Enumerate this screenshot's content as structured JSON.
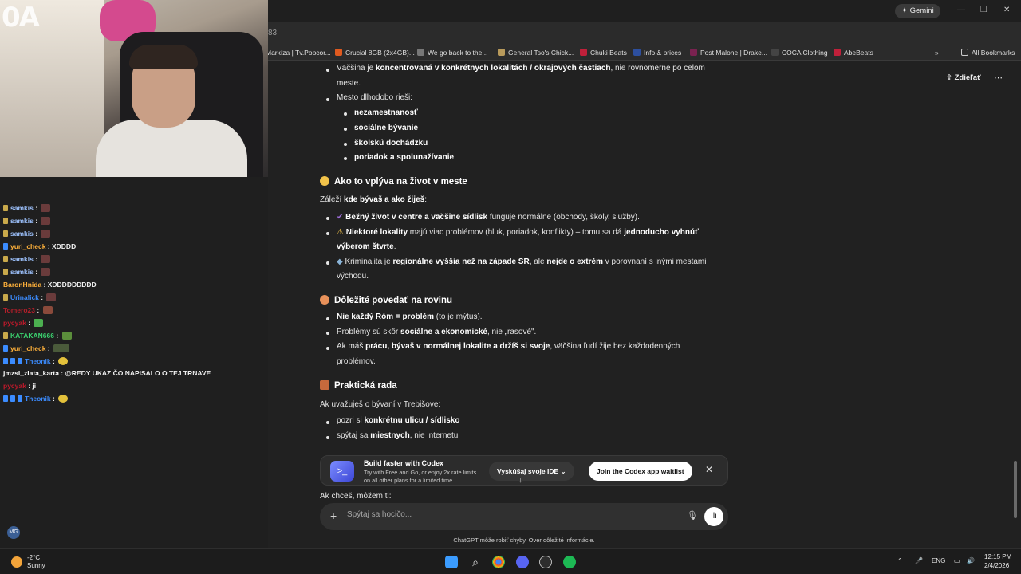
{
  "browser": {
    "gemini_label": "Gemini",
    "url_fragment": "83",
    "bookmarks": [
      {
        "label": "Markíza | Tv.Popcor...",
        "color": "#3a3a3a"
      },
      {
        "label": "Crucial 8GB (2x4GB)...",
        "color": "#e05a1f"
      },
      {
        "label": "We go back to the...",
        "color": "#777777"
      },
      {
        "label": "General Tso's Chick...",
        "color": "#b89a5b"
      },
      {
        "label": "Chuki Beats",
        "color": "#c0203a"
      },
      {
        "label": "Info & prices",
        "color": "#2d4f9e"
      },
      {
        "label": "Post Malone | Drake...",
        "color": "#7a2250"
      },
      {
        "label": "COCA Clothing",
        "color": "#444444"
      },
      {
        "label": "AbeBeats",
        "color": "#c0203a"
      }
    ],
    "all_bookmarks": "All Bookmarks"
  },
  "stream": {
    "cam_overlay_text": "0A",
    "chat": [
      {
        "user": "samkis",
        "color": "#9ec3ff",
        "msg": "",
        "emote": "#6a3b3b"
      },
      {
        "user": "samkis",
        "color": "#9ec3ff",
        "msg": "",
        "emote": "#6a3b3b"
      },
      {
        "user": "samkis",
        "color": "#9ec3ff",
        "msg": "",
        "emote": "#6a3b3b"
      },
      {
        "user": "yuri_check",
        "color": "#ffb13b",
        "msg": "XDDDD",
        "emote": ""
      },
      {
        "user": "samkis",
        "color": "#9ec3ff",
        "msg": "",
        "emote": "#6a3b3b"
      },
      {
        "user": "samkis",
        "color": "#9ec3ff",
        "msg": "",
        "emote": "#6a3b3b"
      },
      {
        "user": "BaronHnida",
        "color": "#ffb13b",
        "msg": "XDDDDDDDDD",
        "emote": ""
      },
      {
        "user": "Urinalick",
        "color": "#3b8cff",
        "msg": "",
        "emote": "#6a3b3b"
      },
      {
        "user": "Tomero23",
        "color": "#b51f2a",
        "msg": "",
        "emote": "#8a4a3b"
      },
      {
        "user": "pycyak",
        "color": "#c2192b",
        "msg": "",
        "emote": "#4caf50"
      },
      {
        "user": "KATAKAN666",
        "color": "#3bd16f",
        "msg": "",
        "emote": "#5b8e3b"
      },
      {
        "user": "yuri_check",
        "color": "#ffb13b",
        "msg": "",
        "emote": "#4a5a3a"
      },
      {
        "user": "Theonik",
        "color": "#3b8cff",
        "msg": "",
        "emote": "#e3c13b"
      },
      {
        "user": "jmzsl_zlata_karta",
        "color": "#ffffff",
        "msg": "@REDY UKAZ ČO  NAPISALO O TEJ TRNAVE",
        "emote": ""
      },
      {
        "user": "pycyak",
        "color": "#c2192b",
        "msg": "ji",
        "emote": ""
      },
      {
        "user": "Theonik",
        "color": "#3b8cff",
        "msg": "",
        "emote": "#e3c13b"
      }
    ],
    "mg_badge": "MG"
  },
  "chatgpt": {
    "share_label": "Zdieľať",
    "more_label": "⋯",
    "lines": {
      "l1_pre": "Väčšina je ",
      "l1_bold": "koncentrovaná v konkrétnych lokalitách / okrajových častiach",
      "l1_post": ", nie rovnomerne po celom",
      "l1_cont": "meste.",
      "l2": "Mesto dlhodobo rieši:",
      "sub": [
        "nezamestnanosť",
        "sociálne bývanie",
        "školskú dochádzku",
        "poriadok a spolunažívanie"
      ],
      "h1": "Ako to vplýva na život v meste",
      "p1_pre": "Záleží ",
      "p1_bold": "kde bývaš a ako žiješ",
      "p1_post": ":",
      "b1_bold": "Bežný život v centre a väčšine sídlisk",
      "b1_post": " funguje normálne (obchody, školy, služby).",
      "b2_bold": "Niektoré lokality",
      "b2_mid": " majú viac problémov (hluk, poriadok, konflikty) – tomu sa dá ",
      "b2_bold2": "jednoducho vyhnúť",
      "b2_cont_bold": "výberom štvrte",
      "b2_cont_post": ".",
      "b3_pre": "Kriminalita je ",
      "b3_bold": "regionálne vyššia než na západe SR",
      "b3_mid": ", ale ",
      "b3_bold2": "nejde o extrém",
      "b3_post": " v porovnaní s inými mestami",
      "b3_cont": "východu.",
      "h2": "Dôležité povedať na rovinu",
      "c1_bold": "Nie každý Róm = problém",
      "c1_post": " (to je mýtus).",
      "c2_pre": "Problémy sú skôr ",
      "c2_bold": "sociálne a ekonomické",
      "c2_post": ", nie „rasové\".",
      "c3_pre": "Ak máš ",
      "c3_bold": "prácu, bývaš v normálnej lokalite a držíš si svoje",
      "c3_post": ", väčšina ľudí žije bez každodenných",
      "c3_cont": "problémov.",
      "h3": "Praktická rada",
      "p2": "Ak uvažuješ o bývaní v Trebišove:",
      "d1_pre": "pozri si ",
      "d1_bold": "konkrétnu ulicu / sídlisko",
      "d2_pre": "spýtaj sa ",
      "d2_bold": "miestnych",
      "d2_post": ", nie internetu",
      "p3": "Ak chceš, môžem ti:"
    },
    "codex": {
      "title": "Build faster with Codex",
      "subtitle": "Try with Free and Go, or enjoy 2x rate limits on all other plans for a limited time.",
      "ide_button": "Vyskúšaj svoje IDE",
      "join_button": "Join the Codex app waitlist"
    },
    "composer_placeholder": "Spýtaj sa hocičo...",
    "disclaimer": "ChatGPT môže robiť chyby. Over dôležité informácie."
  },
  "taskbar": {
    "temp": "-2°C",
    "weather": "Sunny",
    "lang": "ENG",
    "time": "12:15 PM",
    "date": "2/4/2026"
  }
}
